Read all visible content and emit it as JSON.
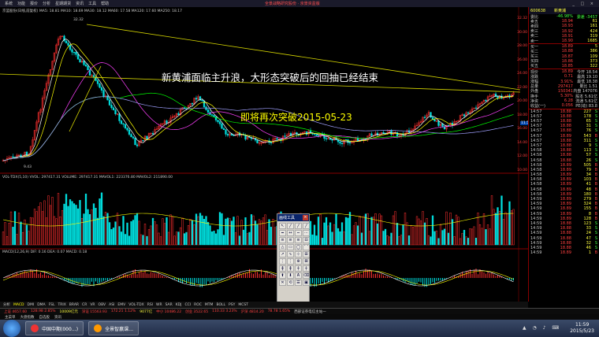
{
  "menubar": {
    "items": [
      "系统",
      "功能",
      "报价",
      "分析",
      "星期期货",
      "资讯",
      "工具",
      "帮助"
    ],
    "brand": "全景战略研究股份 · 京景资盈版",
    "winbtns": "_ □ ×"
  },
  "chart": {
    "header": "京蓝股份(日线,前复权)  MA5: 18.81  MA10: 18.69  MA30: 18.12  MA60: 17.58  MA120: 17.60  MA250: 18.17",
    "annotation1": "新黄浦面临主升浪，大形态突破后的回抽已经结束",
    "annotation2": "即将再次突破2015-05-23",
    "peak_label": "32.32",
    "low_label": "9.43",
    "price_axis": [
      "32.32",
      "30.00",
      "28.00",
      "26.00",
      "24.00",
      "22.00",
      "20.00",
      "18.00",
      "16.00",
      "14.00",
      "12.00",
      "10.00"
    ],
    "volume_header": "VOL-TDX(5,10)  VVOL: 297417.31  VOLUME: 297417.31  MAVOL1: 223376.80  MAVOL2: 211890.00",
    "macd_header": "MACD(12,26,9)  DIF: 0.16  DEA: 0.07  MACD: 0.18",
    "current_price_tag": "11.52"
  },
  "tabs": {
    "items": [
      "分析",
      "MACD",
      "DMI",
      "DMA",
      "FSL",
      "TRIX",
      "BRAR",
      "CR",
      "VR",
      "OBV",
      "ASI",
      "EMV",
      "VOL-TDX",
      "RSI",
      "WR",
      "SAR",
      "KDJ",
      "CCI",
      "ROC",
      "MTM",
      "BOLL",
      "PSY",
      "MCST"
    ],
    "active": "MACD"
  },
  "quote": {
    "code": "600638",
    "name": "新黄浦",
    "header_rows": [
      {
        "k": "委比",
        "v": "-46.98%",
        "x": "委差 -3457"
      }
    ],
    "asks": [
      {
        "k": "卖五",
        "p": "18.94",
        "v": "61"
      },
      {
        "k": "卖四",
        "p": "18.93",
        "v": "161"
      },
      {
        "k": "卖三",
        "p": "18.92",
        "v": "424"
      },
      {
        "k": "卖二",
        "p": "18.91",
        "v": "319"
      },
      {
        "k": "卖一",
        "p": "18.90",
        "v": "1685"
      }
    ],
    "bids": [
      {
        "k": "买一",
        "p": "18.89",
        "v": "5"
      },
      {
        "k": "买二",
        "p": "18.88",
        "v": "386"
      },
      {
        "k": "买三",
        "p": "18.87",
        "v": "109"
      },
      {
        "k": "买四",
        "p": "18.86",
        "v": "373"
      },
      {
        "k": "买五",
        "p": "18.85",
        "v": "322"
      }
    ],
    "stats": [
      {
        "k": "现价",
        "v": "18.89",
        "x": "今开 18.54"
      },
      {
        "k": "涨跌",
        "v": "0.71",
        "x": "最高 19.10"
      },
      {
        "k": "涨幅",
        "v": "3.91%",
        "x": "最低 18.38"
      },
      {
        "k": "总量",
        "v": "297417",
        "x": "量比 1.51"
      },
      {
        "k": "外盘",
        "v": "150341",
        "x": "内盘 147076"
      },
      {
        "k": "换手",
        "v": "5.30%",
        "x": "股本 5.61亿"
      },
      {
        "k": "净资",
        "v": "6.28",
        "x": "流通 5.61亿"
      },
      {
        "k": "收益(一)",
        "v": "0.056",
        "x": "PE(动) 83.8"
      }
    ],
    "ticks": [
      {
        "t": "14:57",
        "p": "18.88",
        "v": "227",
        "d": "S"
      },
      {
        "t": "14:57",
        "p": "18.88",
        "v": "178",
        "d": "S"
      },
      {
        "t": "14:57",
        "p": "18.88",
        "v": "65",
        "d": "S"
      },
      {
        "t": "14:57",
        "p": "18.88",
        "v": "31",
        "d": "S"
      },
      {
        "t": "14:57",
        "p": "18.88",
        "v": "76",
        "d": "S"
      },
      {
        "t": "14:57",
        "p": "18.89",
        "v": "543",
        "d": "B"
      },
      {
        "t": "14:57",
        "p": "18.88",
        "v": "311",
        "d": "S"
      },
      {
        "t": "14:57",
        "p": "18.88",
        "v": "9",
        "d": "S"
      },
      {
        "t": "14:58",
        "p": "18.88",
        "v": "113",
        "d": "S"
      },
      {
        "t": "14:58",
        "p": "18.88",
        "v": "57",
        "d": "S"
      },
      {
        "t": "14:58",
        "p": "18.88",
        "v": "26",
        "d": "S"
      },
      {
        "t": "14:58",
        "p": "18.89",
        "v": "505",
        "d": "B"
      },
      {
        "t": "14:58",
        "p": "18.89",
        "v": "79",
        "d": "B"
      },
      {
        "t": "14:58",
        "p": "18.89",
        "v": "34",
        "d": "B"
      },
      {
        "t": "14:58",
        "p": "18.89",
        "v": "103",
        "d": "B"
      },
      {
        "t": "14:58",
        "p": "18.89",
        "v": "41",
        "d": "B"
      },
      {
        "t": "14:58",
        "p": "18.89",
        "v": "48",
        "d": "B"
      },
      {
        "t": "14:58",
        "p": "18.89",
        "v": "180",
        "d": "B"
      },
      {
        "t": "14:59",
        "p": "18.89",
        "v": "279",
        "d": "B"
      },
      {
        "t": "14:59",
        "p": "18.89",
        "v": "324",
        "d": "B"
      },
      {
        "t": "14:59",
        "p": "18.89",
        "v": "155",
        "d": "B"
      },
      {
        "t": "14:59",
        "p": "18.89",
        "v": "8",
        "d": "B"
      },
      {
        "t": "14:59",
        "p": "18.89",
        "v": "128",
        "d": "B"
      },
      {
        "t": "14:59",
        "p": "18.88",
        "v": "123",
        "d": "S"
      },
      {
        "t": "14:59",
        "p": "18.88",
        "v": "33",
        "d": "S"
      },
      {
        "t": "14:59",
        "p": "18.88",
        "v": "24",
        "d": "S"
      },
      {
        "t": "14:59",
        "p": "18.88",
        "v": "47",
        "d": "S"
      },
      {
        "t": "14:59",
        "p": "18.88",
        "v": "32",
        "d": "S"
      },
      {
        "t": "14:59",
        "p": "18.88",
        "v": "46",
        "d": "S"
      },
      {
        "t": "14:59",
        "p": "18.89",
        "v": "1",
        "d": "B"
      }
    ]
  },
  "toolbox": {
    "title": "画线工具",
    "close": "×",
    "tools": [
      "↖",
      "╱",
      "╱",
      "╱",
      "━",
      "↔",
      "┅",
      "⋯",
      "≡",
      "≡",
      "≡",
      "⊟",
      "△",
      "▭",
      "◯",
      "⌒",
      "↗",
      "∿",
      "⊹",
      "⊞",
      "⋮",
      "⋮",
      "⊕",
      "⊠",
      "╫",
      "╫",
      "┼",
      "┼",
      "⬆",
      "⬇",
      "A",
      "⌫",
      "✕",
      "⟲",
      "☰",
      "▣"
    ]
  },
  "status": [
    {
      "t": "上证 4657.60",
      "c": "red"
    },
    {
      "t": "128.98 2.85%",
      "c": "red"
    },
    {
      "t": "10009亿元",
      "c": "yel"
    },
    {
      "t": "深证 15563.93",
      "c": "red"
    },
    {
      "t": "172.21 1.12%",
      "c": "red"
    },
    {
      "t": "9077亿",
      "c": "yel"
    },
    {
      "t": "中小 10486.22",
      "c": "red"
    },
    {
      "t": "创业 3522.65",
      "c": "red"
    },
    {
      "t": "110.33 3.23%",
      "c": "red"
    },
    {
      "t": "沪深 4814.20",
      "c": "red"
    },
    {
      "t": "78.78 1.65%",
      "c": "red"
    },
    {
      "t": "西部证券电信主站一",
      "c": ""
    }
  ],
  "status2": [
    "主菜单",
    "大盘指数",
    "自选股",
    "资讯"
  ],
  "taskbar": {
    "buttons": [
      "中国中期(000…)",
      "全景智赢课…"
    ],
    "time": "11:59",
    "date": "2015/5/23"
  }
}
